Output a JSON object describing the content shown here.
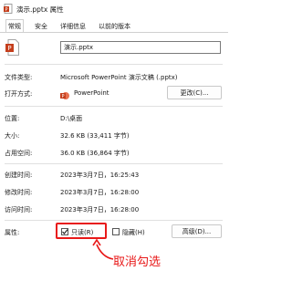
{
  "window": {
    "title": "演示.pptx 属性"
  },
  "tabs": [
    {
      "label": "常规",
      "active": true
    },
    {
      "label": "安全"
    },
    {
      "label": "详细信息"
    },
    {
      "label": "以前的版本"
    }
  ],
  "general": {
    "file_name": "演示.pptx",
    "file_type": {
      "label": "文件类型:",
      "value": "Microsoft PowerPoint 演示文稿 (.pptx)"
    },
    "opens_with": {
      "label": "打开方式:",
      "app": "PowerPoint",
      "change_button": "更改(C)..."
    },
    "location": {
      "label": "位置:",
      "value": "D:\\桌面"
    },
    "size": {
      "label": "大小:",
      "value": "32.6 KB (33,411 字节)"
    },
    "size_on_disk": {
      "label": "占用空间:",
      "value": "36.0 KB (36,864 字节)"
    },
    "created": {
      "label": "创建时间:",
      "value": "2023年3月7日，16:25:43"
    },
    "modified": {
      "label": "修改时间:",
      "value": "2023年3月7日，16:28:00"
    },
    "accessed": {
      "label": "访问时间:",
      "value": "2023年3月7日，16:28:00"
    },
    "attributes": {
      "label": "属性:",
      "readonly_label": "只读(R)",
      "readonly_checked": true,
      "hidden_label": "隐藏(H)",
      "hidden_checked": false,
      "advanced_button": "高级(D)..."
    }
  },
  "annotation": {
    "text": "取消勾选",
    "color": "#e81919"
  },
  "colors": {
    "powerpoint": "#c43e1c",
    "highlight": "#e81919"
  },
  "icons": {
    "title": "pptx-file-icon",
    "app": "powerpoint-icon",
    "arrow": "arrow-icon"
  }
}
